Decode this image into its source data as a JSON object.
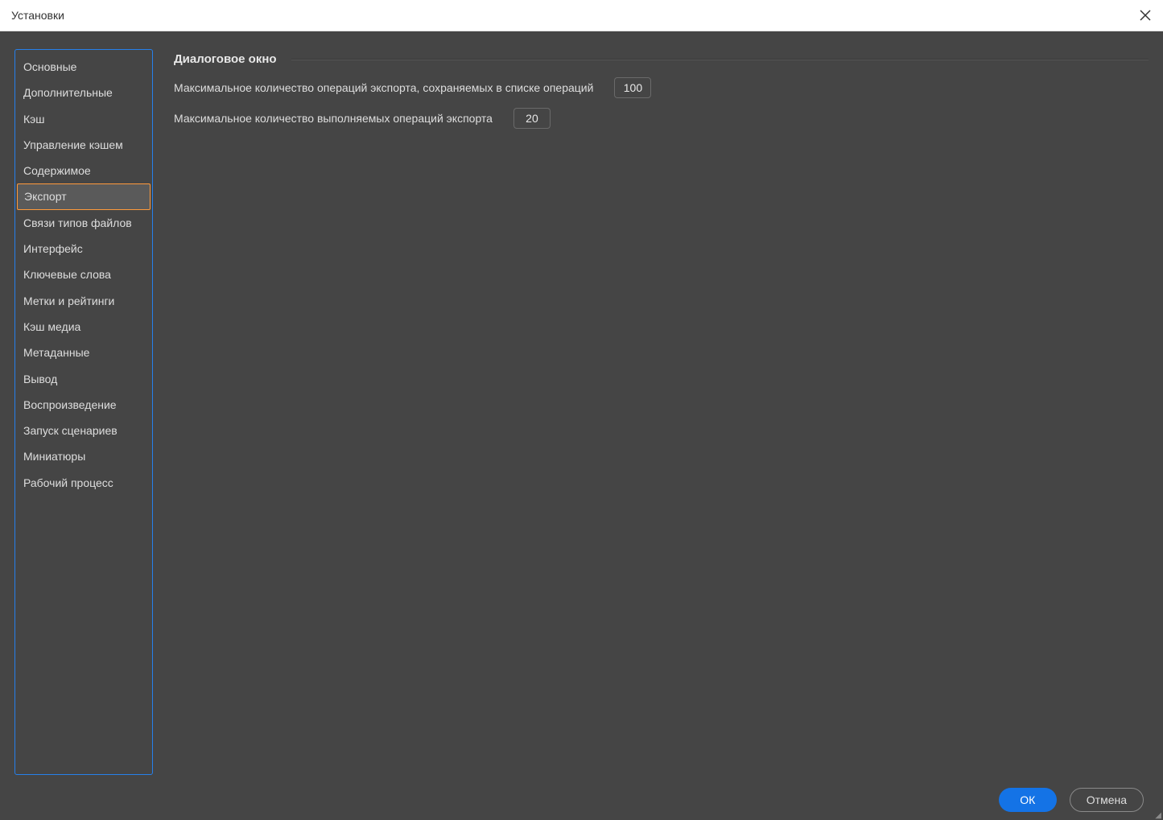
{
  "titlebar": {
    "title": "Установки"
  },
  "sidebar": {
    "items": [
      {
        "label": "Основные",
        "selected": false
      },
      {
        "label": "Дополнительные",
        "selected": false
      },
      {
        "label": "Кэш",
        "selected": false
      },
      {
        "label": "Управление кэшем",
        "selected": false
      },
      {
        "label": "Содержимое",
        "selected": false
      },
      {
        "label": "Экспорт",
        "selected": true
      },
      {
        "label": "Связи типов файлов",
        "selected": false
      },
      {
        "label": "Интерфейс",
        "selected": false
      },
      {
        "label": "Ключевые слова",
        "selected": false
      },
      {
        "label": "Метки и рейтинги",
        "selected": false
      },
      {
        "label": "Кэш медиа",
        "selected": false
      },
      {
        "label": "Метаданные",
        "selected": false
      },
      {
        "label": "Вывод",
        "selected": false
      },
      {
        "label": "Воспроизведение",
        "selected": false
      },
      {
        "label": "Запуск сценариев",
        "selected": false
      },
      {
        "label": "Миниатюры",
        "selected": false
      },
      {
        "label": "Рабочий процесс",
        "selected": false
      }
    ]
  },
  "panel": {
    "section_title": "Диалоговое окно",
    "rows": [
      {
        "label": "Максимальное количество операций экспорта, сохраняемых в списке операций",
        "value": "100"
      },
      {
        "label": "Максимальное количество выполняемых операций экспорта",
        "value": "20"
      }
    ]
  },
  "footer": {
    "ok_label": "ОК",
    "cancel_label": "Отмена"
  }
}
